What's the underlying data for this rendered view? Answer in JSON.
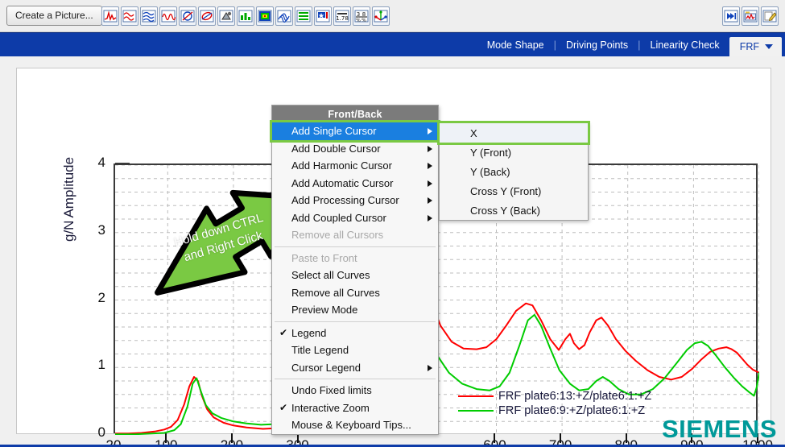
{
  "toolbar": {
    "create_picture_label": "Create a Picture...",
    "left_icons": [
      {
        "name": "time-signal-icon"
      },
      {
        "name": "overlay-waveform-icon"
      },
      {
        "name": "multi-waveform-icon"
      },
      {
        "name": "modulated-wave-icon"
      },
      {
        "name": "nyquist-circle-icon"
      },
      {
        "name": "orbit-plot-icon"
      },
      {
        "name": "geometry-mesh-icon"
      },
      {
        "name": "bar-chart-icon"
      },
      {
        "name": "colormap-icon"
      },
      {
        "name": "waterfall-icon"
      },
      {
        "name": "list-table-icon"
      },
      {
        "name": "annotation-flag-icon"
      },
      {
        "name": "numeric-value-icon"
      },
      {
        "name": "fraction-icon"
      },
      {
        "name": "axis-tripod-icon"
      }
    ],
    "right_icons": [
      {
        "name": "fast-forward-icon"
      },
      {
        "name": "picture-add-icon"
      },
      {
        "name": "edit-pencil-icon"
      }
    ]
  },
  "navbar": {
    "items": [
      "Mode Shape",
      "Driving Points",
      "Linearity Check"
    ],
    "separator": "|",
    "active_tab": "FRF",
    "active_tab_icon": "chevron-down-icon"
  },
  "chart_data": {
    "type": "line",
    "title": "",
    "xlabel": "",
    "ylabel": "Amplitude",
    "yunit": "g/N",
    "xlim": [
      20,
      1000
    ],
    "ylim": [
      0,
      4
    ],
    "xticks": [
      "20",
      "100",
      "200",
      "300",
      "600",
      "700",
      "800",
      "900",
      "1000"
    ],
    "xtick_positions": [
      20,
      100,
      200,
      300,
      600,
      700,
      800,
      900,
      1000
    ],
    "yticks": [
      "0",
      "1",
      "2",
      "3",
      "4"
    ],
    "ytick_positions": [
      0,
      1,
      2,
      3,
      4
    ],
    "grid": true,
    "legend_position": "inside-right",
    "series": [
      {
        "name": "FRF plate6:13:+Z/plate6:1:+Z",
        "color": "#ff0000",
        "points": [
          [
            20,
            0.02
          ],
          [
            40,
            0.02
          ],
          [
            60,
            0.03
          ],
          [
            80,
            0.05
          ],
          [
            95,
            0.08
          ],
          [
            105,
            0.12
          ],
          [
            115,
            0.22
          ],
          [
            125,
            0.45
          ],
          [
            133,
            0.72
          ],
          [
            140,
            0.86
          ],
          [
            146,
            0.8
          ],
          [
            152,
            0.58
          ],
          [
            160,
            0.38
          ],
          [
            170,
            0.26
          ],
          [
            185,
            0.18
          ],
          [
            200,
            0.14
          ],
          [
            220,
            0.11
          ],
          [
            245,
            0.09
          ],
          [
            265,
            0.1
          ],
          [
            285,
            0.13
          ],
          [
            305,
            0.19
          ],
          [
            325,
            0.28
          ],
          [
            345,
            0.42
          ],
          [
            365,
            0.62
          ],
          [
            385,
            0.92
          ],
          [
            400,
            1.25
          ],
          [
            415,
            1.72
          ],
          [
            428,
            2.3
          ],
          [
            440,
            2.9
          ],
          [
            450,
            3.35
          ],
          [
            458,
            3.52
          ],
          [
            466,
            3.38
          ],
          [
            476,
            2.95
          ],
          [
            488,
            2.45
          ],
          [
            500,
            2.0
          ],
          [
            515,
            1.62
          ],
          [
            532,
            1.38
          ],
          [
            550,
            1.28
          ],
          [
            570,
            1.27
          ],
          [
            585,
            1.3
          ],
          [
            600,
            1.42
          ],
          [
            615,
            1.62
          ],
          [
            630,
            1.84
          ],
          [
            645,
            1.95
          ],
          [
            655,
            1.92
          ],
          [
            668,
            1.7
          ],
          [
            682,
            1.42
          ],
          [
            695,
            1.26
          ],
          [
            705,
            1.42
          ],
          [
            712,
            1.5
          ],
          [
            718,
            1.36
          ],
          [
            726,
            1.27
          ],
          [
            734,
            1.33
          ],
          [
            742,
            1.52
          ],
          [
            752,
            1.7
          ],
          [
            760,
            1.74
          ],
          [
            770,
            1.62
          ],
          [
            782,
            1.42
          ],
          [
            796,
            1.25
          ],
          [
            812,
            1.1
          ],
          [
            830,
            0.96
          ],
          [
            848,
            0.86
          ],
          [
            866,
            0.82
          ],
          [
            882,
            0.86
          ],
          [
            898,
            0.98
          ],
          [
            912,
            1.12
          ],
          [
            925,
            1.23
          ],
          [
            938,
            1.28
          ],
          [
            950,
            1.3
          ],
          [
            958,
            1.27
          ],
          [
            966,
            1.22
          ],
          [
            974,
            1.13
          ],
          [
            982,
            1.04
          ],
          [
            990,
            0.97
          ],
          [
            1000,
            0.92
          ]
        ]
      },
      {
        "name": "FRF plate6:9:+Z/plate6:1:+Z",
        "color": "#00cc00",
        "points": [
          [
            20,
            0.01
          ],
          [
            50,
            0.01
          ],
          [
            75,
            0.02
          ],
          [
            95,
            0.03
          ],
          [
            110,
            0.07
          ],
          [
            120,
            0.16
          ],
          [
            130,
            0.42
          ],
          [
            138,
            0.76
          ],
          [
            144,
            0.84
          ],
          [
            150,
            0.66
          ],
          [
            158,
            0.44
          ],
          [
            168,
            0.32
          ],
          [
            182,
            0.25
          ],
          [
            200,
            0.2
          ],
          [
            220,
            0.17
          ],
          [
            242,
            0.15
          ],
          [
            262,
            0.16
          ],
          [
            282,
            0.2
          ],
          [
            302,
            0.27
          ],
          [
            322,
            0.38
          ],
          [
            342,
            0.53
          ],
          [
            362,
            0.74
          ],
          [
            382,
            1.02
          ],
          [
            400,
            1.32
          ],
          [
            415,
            1.7
          ],
          [
            428,
            2.14
          ],
          [
            440,
            2.56
          ],
          [
            450,
            2.76
          ],
          [
            458,
            2.68
          ],
          [
            468,
            2.36
          ],
          [
            480,
            1.94
          ],
          [
            494,
            1.52
          ],
          [
            510,
            1.18
          ],
          [
            528,
            0.92
          ],
          [
            548,
            0.76
          ],
          [
            570,
            0.68
          ],
          [
            590,
            0.66
          ],
          [
            605,
            0.72
          ],
          [
            620,
            0.92
          ],
          [
            635,
            1.32
          ],
          [
            648,
            1.7
          ],
          [
            658,
            1.78
          ],
          [
            668,
            1.62
          ],
          [
            682,
            1.28
          ],
          [
            696,
            0.96
          ],
          [
            712,
            0.76
          ],
          [
            726,
            0.66
          ],
          [
            740,
            0.68
          ],
          [
            752,
            0.8
          ],
          [
            762,
            0.86
          ],
          [
            772,
            0.8
          ],
          [
            786,
            0.68
          ],
          [
            802,
            0.6
          ],
          [
            820,
            0.6
          ],
          [
            838,
            0.68
          ],
          [
            856,
            0.84
          ],
          [
            874,
            1.06
          ],
          [
            890,
            1.26
          ],
          [
            902,
            1.36
          ],
          [
            912,
            1.38
          ],
          [
            922,
            1.32
          ],
          [
            934,
            1.18
          ],
          [
            948,
            1.0
          ],
          [
            962,
            0.84
          ],
          [
            974,
            0.72
          ],
          [
            984,
            0.64
          ],
          [
            992,
            0.58
          ],
          [
            996,
            0.7
          ],
          [
            1000,
            0.92
          ]
        ]
      }
    ]
  },
  "callout": {
    "line1": "Hold down CTRL",
    "line2": "and Right Click",
    "color": "#7ac943"
  },
  "context_menu": {
    "header": "Front/Back",
    "items": [
      {
        "label": "Add Single Cursor",
        "submenu": true,
        "checked": false,
        "disabled": false,
        "selected": true
      },
      {
        "label": "Add Double Cursor",
        "submenu": true,
        "checked": false,
        "disabled": false,
        "selected": false
      },
      {
        "label": "Add Harmonic Cursor",
        "submenu": true,
        "checked": false,
        "disabled": false,
        "selected": false
      },
      {
        "label": "Add Automatic Cursor",
        "submenu": true,
        "checked": false,
        "disabled": false,
        "selected": false
      },
      {
        "label": "Add Processing Cursor",
        "submenu": true,
        "checked": false,
        "disabled": false,
        "selected": false
      },
      {
        "label": "Add Coupled Cursor",
        "submenu": true,
        "checked": false,
        "disabled": false,
        "selected": false
      },
      {
        "label": "Remove all Cursors",
        "submenu": false,
        "checked": false,
        "disabled": true,
        "selected": false
      },
      {
        "separator": true
      },
      {
        "label": "Paste to Front",
        "submenu": false,
        "checked": false,
        "disabled": true,
        "selected": false
      },
      {
        "label": "Select all Curves",
        "submenu": false,
        "checked": false,
        "disabled": false,
        "selected": false
      },
      {
        "label": "Remove all Curves",
        "submenu": false,
        "checked": false,
        "disabled": false,
        "selected": false
      },
      {
        "label": "Preview Mode",
        "submenu": false,
        "checked": false,
        "disabled": false,
        "selected": false
      },
      {
        "separator": true
      },
      {
        "label": "Legend",
        "submenu": false,
        "checked": true,
        "disabled": false,
        "selected": false
      },
      {
        "label": "Title Legend",
        "submenu": false,
        "checked": false,
        "disabled": false,
        "selected": false
      },
      {
        "label": "Cursor Legend",
        "submenu": true,
        "checked": false,
        "disabled": false,
        "selected": false
      },
      {
        "separator": true
      },
      {
        "label": "Undo Fixed limits",
        "submenu": false,
        "checked": false,
        "disabled": false,
        "selected": false
      },
      {
        "label": "Interactive Zoom",
        "submenu": false,
        "checked": true,
        "disabled": false,
        "selected": false
      },
      {
        "label": "Mouse & Keyboard Tips...",
        "submenu": false,
        "checked": false,
        "disabled": false,
        "selected": false
      }
    ],
    "check_glyph": "✔"
  },
  "sub_menu": {
    "items": [
      {
        "label": "X",
        "selected": true
      },
      {
        "label": "Y (Front)",
        "selected": false
      },
      {
        "label": "Y (Back)",
        "selected": false
      },
      {
        "label": "Cross Y (Front)",
        "selected": false
      },
      {
        "label": "Cross Y (Back)",
        "selected": false
      }
    ]
  },
  "branding": {
    "logo_text": "SIEMENS",
    "logo_color": "#009999"
  }
}
